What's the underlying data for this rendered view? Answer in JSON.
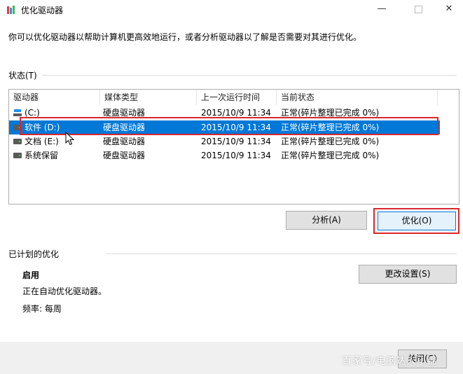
{
  "window": {
    "title": "优化驱动器",
    "minimize_glyph": "—",
    "close_glyph": "✕"
  },
  "description": "你可以优化驱动器以帮助计算机更高效地运行，或者分析驱动器以了解是否需要对其进行优化。",
  "status": {
    "label": "状态(T)",
    "columns": [
      "驱动器",
      "媒体类型",
      "上一次运行时间",
      "当前状态"
    ],
    "rows": [
      {
        "drive": "(C:)",
        "media": "硬盘驱动器",
        "last_run": "2015/10/9 11:34",
        "state": "正常(碎片整理已完成 0%)",
        "selected": false,
        "icon": "windows-drive-icon"
      },
      {
        "drive": "软件 (D:)",
        "media": "硬盘驱动器",
        "last_run": "2015/10/9 11:34",
        "state": "正常(碎片整理已完成 0%)",
        "selected": true,
        "icon": "drive-icon"
      },
      {
        "drive": "文档 (E:)",
        "media": "硬盘驱动器",
        "last_run": "2015/10/9 11:34",
        "state": "正常(碎片整理已完成 0%)",
        "selected": false,
        "icon": "drive-icon"
      },
      {
        "drive": "系统保留",
        "media": "硬盘驱动器",
        "last_run": "2015/10/9 11:34",
        "state": "正常(碎片整理已完成 0%)",
        "selected": false,
        "icon": "drive-icon"
      }
    ]
  },
  "buttons": {
    "analyze": "分析(A)",
    "optimize": "优化(O)",
    "change_settings": "更改设置(S)",
    "close": "关闭(C)"
  },
  "schedule": {
    "label": "已计划的优化",
    "status": "启用",
    "description": "正在自动优化驱动器。",
    "frequency": "频率: 每周"
  },
  "watermark": "百家号/电脑达人小锦",
  "colors": {
    "selection": "#0078d7",
    "highlight_border": "#d8262c",
    "button_face": "#e1e1e1"
  }
}
